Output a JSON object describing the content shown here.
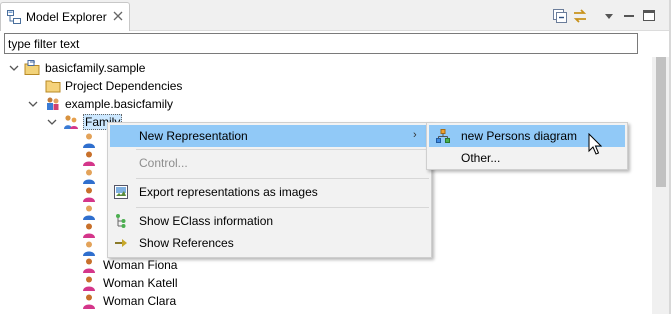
{
  "view": {
    "tab_label": "Model Explorer",
    "icons": [
      "model-explorer-icon",
      "close-icon",
      "collapse-all-icon",
      "link-with-editor-icon",
      "view-menu-icon",
      "minimize-icon",
      "maximize-icon"
    ]
  },
  "filter": {
    "value": "type filter text"
  },
  "tree": {
    "items": [
      {
        "label": "basicfamily.sample",
        "icon": "project-icon",
        "expanded": true
      },
      {
        "label": "Project Dependencies",
        "icon": "folder-icon"
      },
      {
        "label": "example.basicfamily",
        "icon": "resource-icon",
        "expanded": true
      },
      {
        "label": "Family",
        "icon": "family-icon",
        "expanded": true,
        "selected": true
      },
      {
        "label": "Woman Fiona",
        "icon": "woman-icon"
      },
      {
        "label": "Woman Katell",
        "icon": "woman-icon"
      },
      {
        "label": "Woman Clara",
        "icon": "woman-icon"
      }
    ],
    "hidden_children_icons": [
      "man-icon",
      "woman-icon",
      "man-icon",
      "woman-icon",
      "man-icon",
      "woman-icon",
      "man-icon",
      "man-icon"
    ]
  },
  "context_menu": {
    "new_representation": "New Representation",
    "control": "Control...",
    "export": "Export representations as images",
    "show_eclass": "Show EClass information",
    "show_references": "Show References",
    "submenu_arrow": "›"
  },
  "submenu": {
    "new_persons_diagram": "new Persons diagram",
    "other": "Other..."
  },
  "colors": {
    "highlight": "#91c9f7",
    "selection": "#cce8ff",
    "disabled_text": "#8d8d8d"
  }
}
